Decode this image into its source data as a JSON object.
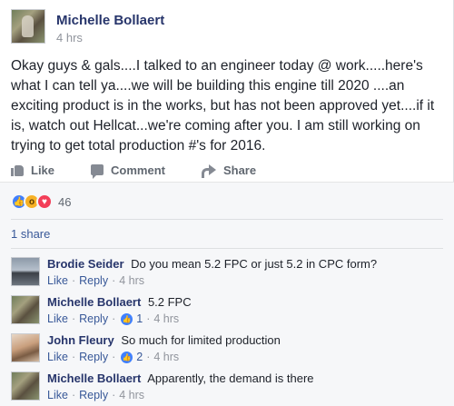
{
  "post": {
    "author": "Michelle Bollaert",
    "time": "4 hrs",
    "body": "Okay guys & gals....I talked to an engineer today @ work.....here's what I can tell ya....we will be building this engine till 2020 ....an exciting product is in the works, but has not been approved yet....if it is, watch out Hellcat...we're coming after you. I am still working on trying to get total production #'s for 2016."
  },
  "actions": {
    "like": "Like",
    "comment": "Comment",
    "share": "Share"
  },
  "reactions": {
    "count": "46",
    "icons": [
      "like-icon",
      "wow-icon",
      "love-icon"
    ],
    "colors": {
      "like": "#4080ff",
      "wow": "#f7b125",
      "love": "#f33e58"
    }
  },
  "shares": "1 share",
  "comments": [
    {
      "author": "Brodie Seider",
      "text": "Do you mean 5.2 FPC or just 5.2 in CPC form?",
      "like": "Like",
      "reply": "Reply",
      "sep": "·",
      "likes": "",
      "time": "4 hrs"
    },
    {
      "author": "Michelle Bollaert",
      "text": "5.2 FPC",
      "like": "Like",
      "reply": "Reply",
      "sep": "·",
      "likes": "1",
      "time": "4 hrs"
    },
    {
      "author": "John Fleury",
      "text": "So much for limited production",
      "like": "Like",
      "reply": "Reply",
      "sep": "·",
      "likes": "2",
      "time": "4 hrs"
    },
    {
      "author": "Michelle Bollaert",
      "text": "Apparently, the demand is there",
      "like": "Like",
      "reply": "Reply",
      "sep": "·",
      "likes": "",
      "time": "4 hrs"
    }
  ],
  "colors": {
    "name": "#27356b",
    "link": "#385898",
    "meta": "#90949c",
    "feedback_bg": "#f6f7f9"
  }
}
